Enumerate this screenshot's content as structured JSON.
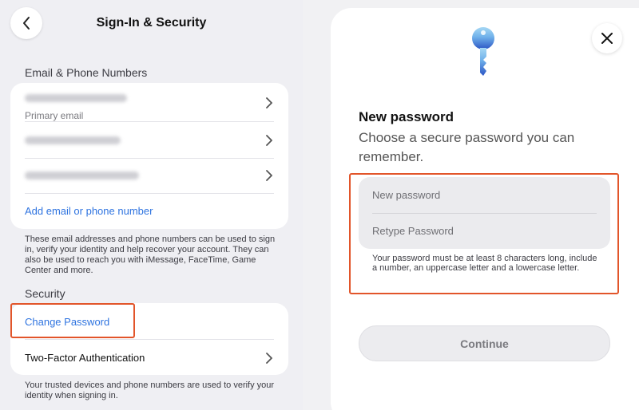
{
  "left": {
    "nav_title": "Sign-In & Security",
    "email_section_header": "Email & Phone Numbers",
    "primary_email_caption": "Primary email",
    "add_contact_link": "Add email or phone number",
    "email_footnote": "These email addresses and phone numbers can be used to sign in, verify your identity and help recover your account. They can also be used to reach you with iMessage, FaceTime, Game Center and more.",
    "security_section_header": "Security",
    "change_password_label": "Change Password",
    "two_factor_label": "Two-Factor Authentication",
    "security_footnote": "Your trusted devices and phone numbers are used to verify your identity when signing in."
  },
  "right": {
    "title": "New password",
    "subtitle": "Choose a secure password you can remember.",
    "new_password_placeholder": "New password",
    "retype_password_placeholder": "Retype Password",
    "hint": "Your password must be at least 8 characters long, include a number, an uppercase letter and a lowercase letter.",
    "continue_label": "Continue"
  },
  "icons": {
    "back": "chevron-left-icon",
    "chevron": "chevron-right-icon",
    "close": "close-icon",
    "key": "key-icon"
  },
  "colors": {
    "accent": "#2f74e0",
    "highlight": "#e2552a",
    "key_light": "#9fd3f2",
    "key_dark": "#2b54c4"
  }
}
